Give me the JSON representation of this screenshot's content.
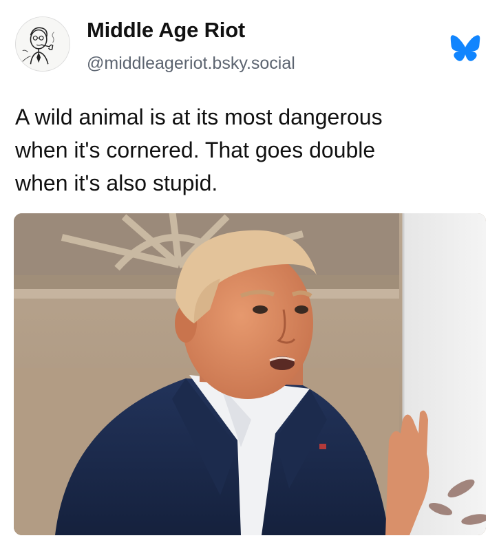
{
  "author": {
    "display_name": "Middle Age Riot",
    "handle": "@middleageriot.bsky.social",
    "avatar_icon": "man-smoking-pipe-sketch-avatar"
  },
  "platform": {
    "logo_icon": "bluesky-butterfly-icon",
    "logo_color": "#1185fe"
  },
  "post": {
    "text_lines": [
      "A wild animal is at its most dangerous",
      "when it's cornered. That goes double",
      "when it's also stupid."
    ]
  },
  "media": {
    "icon": "photo-man-in-navy-suit-beside-white-wall"
  }
}
